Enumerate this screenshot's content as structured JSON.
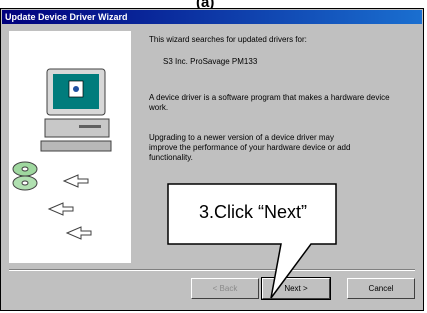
{
  "top_fragment": "(a)",
  "window": {
    "title": "Update Device Driver Wizard"
  },
  "body": {
    "intro": "This wizard searches for updated drivers for:",
    "device": "S3 Inc. ProSavage PM133",
    "explain": "A device driver is a software program that makes a hardware device work.",
    "upgrade_1": "Upgrading to a newer version of a device driver may",
    "upgrade_2": "improve the performance of your hardware device or add",
    "upgrade_3": "functionality."
  },
  "buttons": {
    "back": "< Back",
    "next": "Next >",
    "cancel": "Cancel"
  },
  "callout": {
    "label": "3.Click “Next”"
  }
}
